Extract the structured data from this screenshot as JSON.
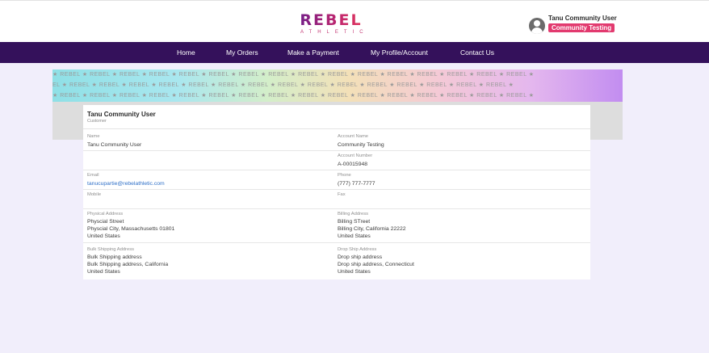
{
  "brand": {
    "name": "REBEL",
    "sub": "ATHLETIC"
  },
  "user": {
    "name": "Tanu Community User",
    "badge": "Community Testing"
  },
  "nav": [
    "Home",
    "My Orders",
    "Make a Payment",
    "My Profile/Account",
    "Contact Us"
  ],
  "banner": {
    "row1": "★ REBEL ★ REBEL ★ REBEL ★ REBEL ★ REBEL ★ REBEL ★ REBEL ★ REBEL ★ REBEL ★ REBEL ★ REBEL ★ REBEL ★ REBEL ★ REBEL ★ REBEL ★ REBEL ★",
    "row2": "EL ★ REBEL ★ REBEL ★ REBEL ★ REBEL ★ REBEL ★ REBEL ★ REBEL ★ REBEL ★ REBEL ★ REBEL ★ REBEL ★ REBEL ★ REBEL ★ REBEL ★ REBEL ★",
    "row3": "★ REBEL ★ REBEL ★ REBEL ★ REBEL ★ REBEL ★ REBEL ★ REBEL ★ REBEL ★ REBEL ★ REBEL ★ REBEL ★ REBEL ★ REBEL ★ REBEL ★ REBEL ★ REBEL ★"
  },
  "profile": {
    "name": "Tanu Community User",
    "role": "Customer",
    "name_label": "Name",
    "name_value": "Tanu Community User",
    "account_name_label": "Account Name",
    "account_name_value": "Community Testing",
    "account_number_label": "Account Number",
    "account_number_value": "A-00015948",
    "email_label": "Email",
    "email_value": "tanucupartie@rebelathletic.com",
    "phone_label": "Phone",
    "phone_value": "(777) 777-7777",
    "mobile_label": "Mobile",
    "fax_label": "Fax",
    "physical_label": "Physical Address",
    "physical_line1": "Physcial Street",
    "physical_line2": "Physcial City, Massachusetts 01801",
    "physical_line3": "United States",
    "billing_label": "Billing Address",
    "billing_line1": "Billing STreet",
    "billing_line2": "Billing City, California 22222",
    "billing_line3": "United States",
    "bulk_label": "Bulk Shipping Address",
    "bulk_line1": "Bulk Shipping address",
    "bulk_line2": "Bulk Shipping address, California",
    "bulk_line3": "United States",
    "dropship_label": "Drop Ship Address",
    "dropship_line1": "Drop ship address",
    "dropship_line2": "Drop ship address, Connecticut",
    "dropship_line3": "United States"
  }
}
